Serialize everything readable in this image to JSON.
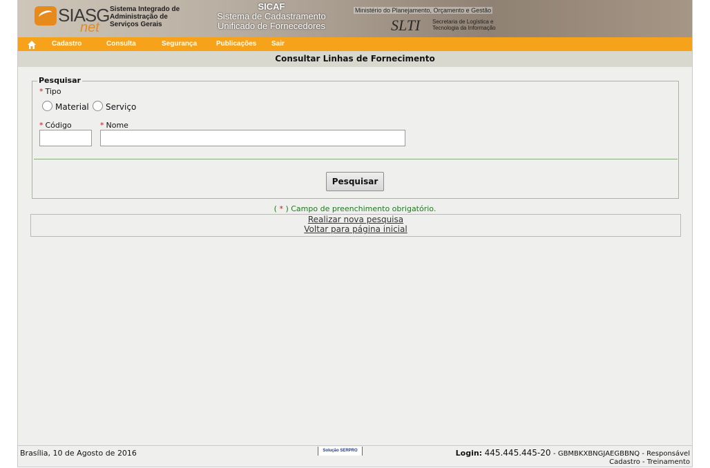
{
  "header": {
    "logo_text": "SIASG",
    "logo_suffix": "net",
    "system_name": "Sistema Integrado de\nAdministração de\nServiços Gerais",
    "sicaf_title": "SICAF",
    "sicaf_subtitle": "Sistema de Cadastramento\nUnificado de Fornecedores",
    "ministry": "Ministério do Planejamento, Orçamento e Gestão",
    "slti_logo": "SLTI",
    "slti_desc": "Secretaria de Logística e\nTecnologia da Informação"
  },
  "menu": {
    "home_icon": "home-icon",
    "items": [
      "Cadastro",
      "Consulta",
      "Segurança",
      "Publicações",
      "Sair"
    ]
  },
  "page_title": "Consultar Linhas de Fornecimento",
  "form": {
    "legend": "Pesquisar",
    "tipo_label": "Tipo",
    "tipo_options": [
      "Material",
      "Serviço"
    ],
    "codigo_label": "Código",
    "codigo_value": "",
    "nome_label": "Nome",
    "nome_value": "",
    "required_marker": "*",
    "submit_label": "Pesquisar"
  },
  "required_note": {
    "open": "(",
    "star": "*",
    "close": ")",
    "text": "Campo de preenchimento obrigatório."
  },
  "links": {
    "new_search": "Realizar nova pesquisa",
    "back_home": "Voltar para página inicial"
  },
  "footer": {
    "date": "Brasília, 10 de Agosto de 2016",
    "serpro_badge": "Solução SERPRO",
    "login_label": "Login:",
    "login_cpf": "445.445.445-20",
    "login_user": "- GBMBKXBNGJAEGBBNQ - Responsável",
    "login_profile": "Cadastro - Treinamento"
  },
  "colors": {
    "menu_bar": "#f7a21b",
    "title_bar": "#d8d8cf",
    "required": "#d01515",
    "note_green": "#1a7a1a"
  }
}
